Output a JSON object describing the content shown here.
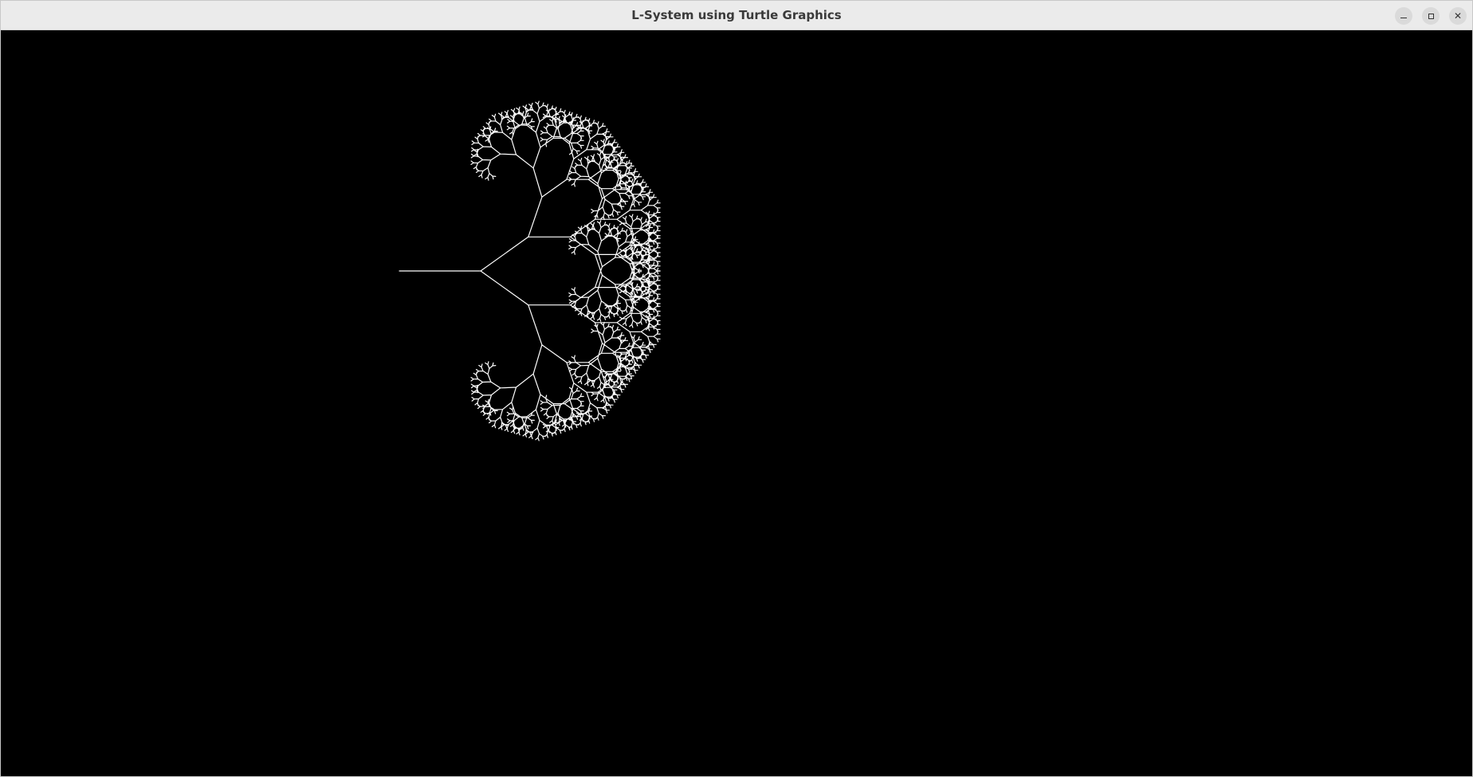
{
  "window": {
    "title": "L-System using Turtle Graphics",
    "controls": {
      "minimize_icon": "minimize-icon",
      "maximize_icon": "maximize-icon",
      "close_icon": "close-icon"
    }
  },
  "canvas": {
    "background": "#000000",
    "stroke_color": "#ffffff",
    "drawing": "fractal-tree"
  }
}
